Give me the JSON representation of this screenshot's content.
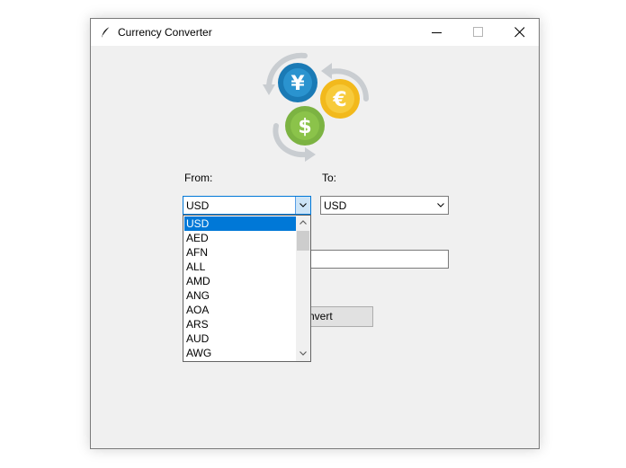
{
  "window": {
    "title": "Currency Converter",
    "icon": "feather-icon"
  },
  "converter": {
    "from_label": "From:",
    "to_label": "To:",
    "from_value": "USD",
    "to_value": "USD",
    "amount_value": "",
    "convert_label": "Convert",
    "convert_visible_text": "nvert"
  },
  "logo": {
    "yen_symbol": "¥",
    "euro_symbol": "€",
    "dollar_symbol": "$",
    "colors": {
      "yen": "#1a7ab5",
      "euro": "#f2b91c",
      "dollar": "#7cb342",
      "arrows": "#c9cdd1"
    }
  },
  "dropdown": {
    "items": [
      "USD",
      "AED",
      "AFN",
      "ALL",
      "AMD",
      "ANG",
      "AOA",
      "ARS",
      "AUD",
      "AWG"
    ],
    "selected_index": 0
  },
  "colors": {
    "selection": "#0078d7",
    "focus_border": "#0078d7"
  }
}
